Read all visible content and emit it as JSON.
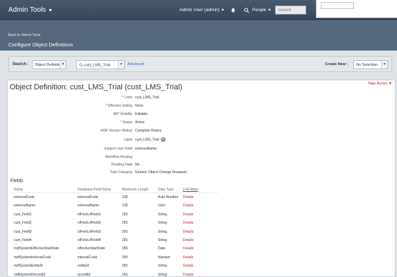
{
  "topbar": {
    "app_title": "Admin Tools",
    "user": "Admin User (admin)",
    "people": "People",
    "search_placeholder": "Search"
  },
  "header": {
    "back_link": "Back to: Admin Tools",
    "page_title": "Configure Object Definitions"
  },
  "search_bar": {
    "label": "Search :",
    "type_select": "Object Definition",
    "value": "cust_LMS_Trial",
    "advanced": "Advanced",
    "create_new_label": "Create New :",
    "create_new_select": "No Selection"
  },
  "object": {
    "title": "Object Definition: cust_LMS_Trial (cust_LMS_Trial)",
    "take_action": "Take Action",
    "properties": [
      {
        "label": "* Code",
        "value": "cust_LMS_Trial"
      },
      {
        "label": "* Effective Dating",
        "value": "None"
      },
      {
        "label": "API Visibility",
        "value": "Editable"
      },
      {
        "label": "* Status",
        "value": "Active"
      },
      {
        "label": "MDF Version History",
        "value": "Complete History"
      },
      {
        "label": "Label",
        "value": "cust_LMS_Trial"
      },
      {
        "label": "Subject User Field",
        "value": "externalName"
      },
      {
        "label": "Workflow Routing",
        "value": ""
      },
      {
        "label": "Pending Data",
        "value": "No"
      },
      {
        "label": "Todo Category",
        "value": "Generic Object Change Requests"
      }
    ]
  },
  "fields": {
    "heading": "Fields",
    "columns": [
      "Name",
      "Database Field Name",
      "Maximum Length",
      "Data Type",
      "(+4) More"
    ],
    "rows": [
      {
        "name": "externalCode",
        "db": "externalCode",
        "max": "128",
        "type": "Auto Number",
        "details": "Details"
      },
      {
        "name": "externalName",
        "db": "externalName",
        "max": "128",
        "type": "User",
        "details": "Details"
      },
      {
        "name": "cust_Field1",
        "db": "sfField.sfField1",
        "max": "255",
        "type": "String",
        "details": "Details"
      },
      {
        "name": "cust_Field2",
        "db": "sfField.sfField2",
        "max": "255",
        "type": "String",
        "details": "Details"
      },
      {
        "name": "cust_Field3",
        "db": "sfField.sfField3",
        "max": "255",
        "type": "String",
        "details": "Details"
      },
      {
        "name": "cust_Field4",
        "db": "sfField.sfField4",
        "max": "255",
        "type": "String",
        "details": "Details"
      },
      {
        "name": "mdfSystemEffectiveStartDate",
        "db": "effectiveStartDate",
        "max": "255",
        "type": "Date",
        "details": "Details"
      },
      {
        "name": "mdfSystemInternalCode",
        "db": "internalCode",
        "max": "255",
        "type": "Number",
        "details": "Details"
      },
      {
        "name": "mdfSystemEntityId",
        "db": "entityId",
        "max": "255",
        "type": "String",
        "details": "Details"
      },
      {
        "name": "mdfSystemRecordId",
        "db": "recordId",
        "max": "255",
        "type": "String",
        "details": "Details"
      }
    ]
  }
}
